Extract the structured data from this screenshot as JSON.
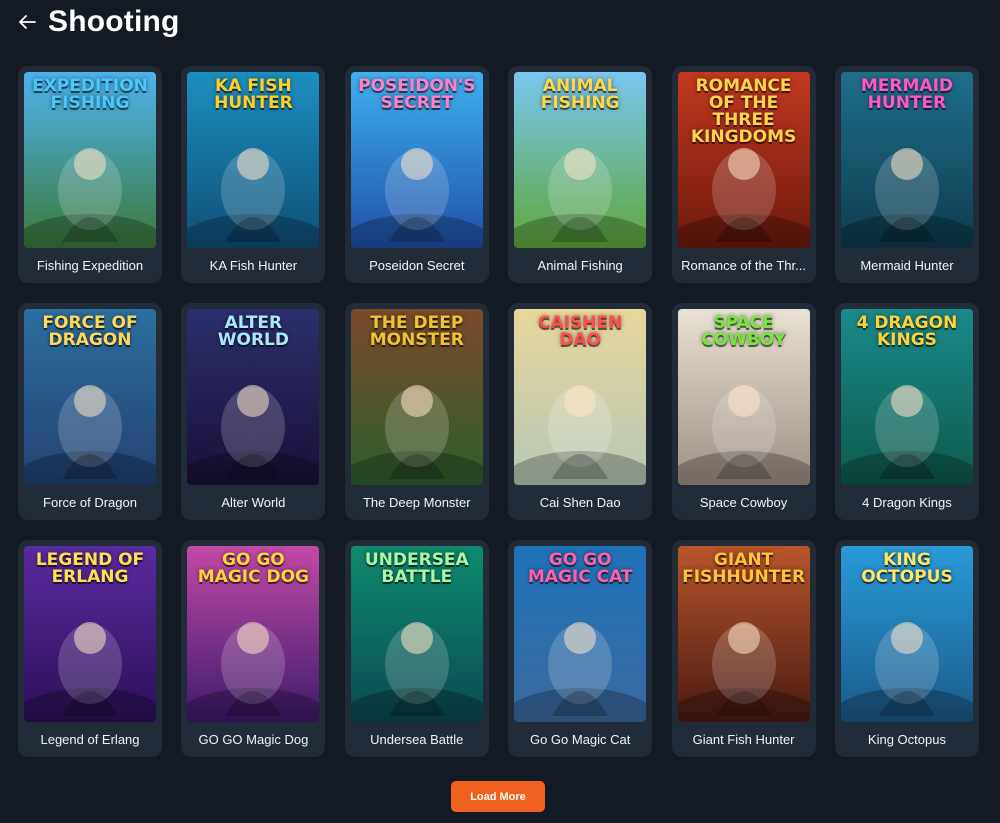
{
  "header": {
    "title": "Shooting",
    "back_icon": "arrow-left-icon"
  },
  "games": [
    {
      "id": "fishing-expedition",
      "title": "Fishing Expedition",
      "art_logo": "EXPEDITION FISHING",
      "colors": [
        "#4fb3ef",
        "#3a7a3a"
      ],
      "logo_color": "#49c7ff",
      "figure": "fisherman-icon"
    },
    {
      "id": "ka-fish-hunter",
      "title": "KA Fish Hunter",
      "art_logo": "KA FISH HUNTER",
      "colors": [
        "#1b8fbf",
        "#0f4f78"
      ],
      "logo_color": "#ffcf27",
      "figure": "shark-icon"
    },
    {
      "id": "poseidon-secret",
      "title": "Poseidon Secret",
      "art_logo": "POSEIDON'S SECRET",
      "colors": [
        "#3fb0ee",
        "#1e4fa8"
      ],
      "logo_color": "#ff7fc8",
      "figure": "poseidon-icon"
    },
    {
      "id": "animal-fishing",
      "title": "Animal Fishing",
      "art_logo": "ANIMAL FISHING",
      "colors": [
        "#79c6f0",
        "#5ea83b"
      ],
      "logo_color": "#ffd84a",
      "figure": "raccoon-icon"
    },
    {
      "id": "romance-three-kingdoms",
      "title": "Romance of the Thr...",
      "art_logo": "ROMANCE OF THE THREE KINGDOMS",
      "colors": [
        "#c2381f",
        "#6e1a0e"
      ],
      "logo_color": "#ffd34d",
      "figure": "warrior-icon"
    },
    {
      "id": "mermaid-hunter",
      "title": "Mermaid Hunter",
      "art_logo": "MERMAID HUNTER",
      "colors": [
        "#1e6f8a",
        "#0d3c4d"
      ],
      "logo_color": "#ff57c5",
      "figure": "mermaid-icon"
    },
    {
      "id": "force-of-dragon",
      "title": "Force of Dragon",
      "art_logo": "Force of Dragon",
      "colors": [
        "#2b6f9e",
        "#234172"
      ],
      "logo_color": "#ffd85c",
      "figure": "dragon-icon"
    },
    {
      "id": "alter-world",
      "title": "Alter World",
      "art_logo": "ALTER WORLD",
      "colors": [
        "#2c2f6e",
        "#1a1038"
      ],
      "logo_color": "#a9e6ff",
      "figure": "dark-lady-icon"
    },
    {
      "id": "the-deep-monster",
      "title": "The Deep Monster",
      "art_logo": "THE DEEP MONSTER",
      "colors": [
        "#7a4a2a",
        "#2e5f2b"
      ],
      "logo_color": "#f1c232",
      "figure": "crocodile-icon"
    },
    {
      "id": "cai-shen-dao",
      "title": "Cai Shen Dao",
      "art_logo": "CAISHEN DAO",
      "colors": [
        "#e8d79a",
        "#b7c7b8"
      ],
      "logo_color": "#ff4d4d",
      "figure": "god-of-wealth-icon"
    },
    {
      "id": "space-cowboy",
      "title": "Space Cowboy",
      "art_logo": "SPACE COWBOY",
      "colors": [
        "#e9e1d3",
        "#9e8f84"
      ],
      "logo_color": "#76e83a",
      "figure": "cowgirl-icon"
    },
    {
      "id": "4-dragon-kings",
      "title": "4 Dragon Kings",
      "art_logo": "4 DRAGON KINGS",
      "colors": [
        "#1a8a8a",
        "#0d5a4a"
      ],
      "logo_color": "#ffd23a",
      "figure": "dragon-king-icon"
    },
    {
      "id": "legend-of-erlang",
      "title": "Legend of Erlang",
      "art_logo": "LEGEND OF ERLANG",
      "colors": [
        "#5a2aa0",
        "#2b1058"
      ],
      "logo_color": "#ffe14d",
      "figure": "erlang-icon"
    },
    {
      "id": "go-go-magic-dog",
      "title": "GO GO Magic Dog",
      "art_logo": "GO GO MAGIC DOG",
      "colors": [
        "#c24aa6",
        "#3d1a6e"
      ],
      "logo_color": "#ffd23a",
      "figure": "magic-dog-icon"
    },
    {
      "id": "undersea-battle",
      "title": "Undersea Battle",
      "art_logo": "UNDERSEA BATTLE",
      "colors": [
        "#0f8a6e",
        "#0a4a52"
      ],
      "logo_color": "#a6f7a6",
      "figure": "squid-warrior-icon"
    },
    {
      "id": "go-go-magic-cat",
      "title": "Go Go Magic Cat",
      "art_logo": "GO GO MAGIC CAT",
      "colors": [
        "#1e72b8",
        "#3a6aa0"
      ],
      "logo_color": "#ff5fa8",
      "figure": "magic-cat-icon"
    },
    {
      "id": "giant-fish-hunter",
      "title": "Giant Fish Hunter",
      "art_logo": "GIANT FISHHUNTER",
      "colors": [
        "#b8552a",
        "#4a1a14"
      ],
      "logo_color": "#ffc23a",
      "figure": "giant-fish-icon"
    },
    {
      "id": "king-octopus",
      "title": "King Octopus",
      "art_logo": "KING OCTOPUS",
      "colors": [
        "#2a9ad8",
        "#1a5a8a"
      ],
      "logo_color": "#ffe766",
      "figure": "octopus-icon"
    }
  ],
  "load_more": {
    "label": "Load More"
  }
}
